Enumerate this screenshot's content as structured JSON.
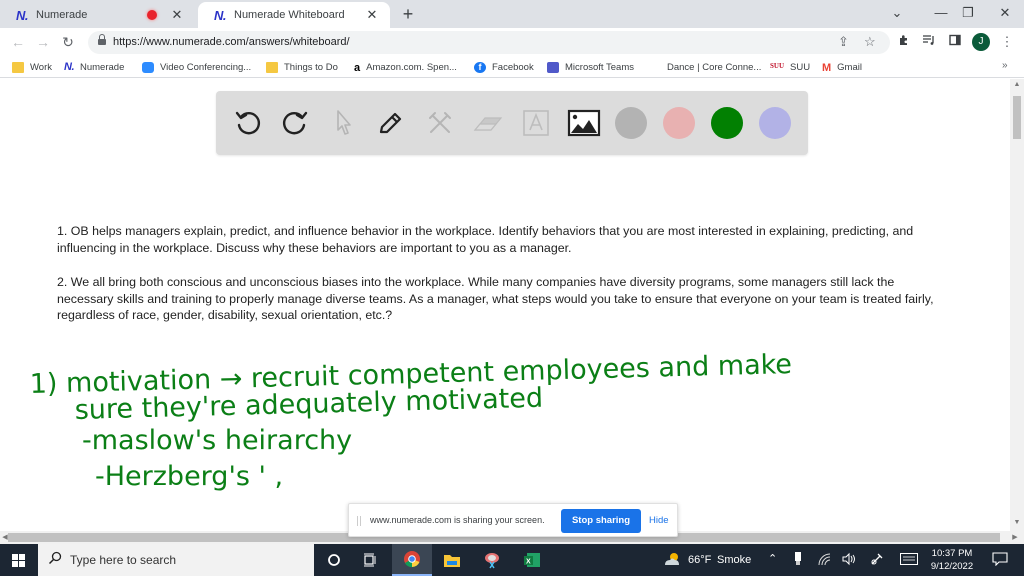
{
  "browser": {
    "tabs": [
      {
        "title": "Numerade",
        "logo": "N.",
        "recording": true,
        "active": false
      },
      {
        "title": "Numerade Whiteboard",
        "logo": "N.",
        "recording": false,
        "active": true
      }
    ],
    "new_tab_icon": "+",
    "window_controls": {
      "tab_search": "⌄",
      "minimize": "—",
      "restore": "❐",
      "close": "✕"
    },
    "nav": {
      "back": "←",
      "forward": "→",
      "reload": "↻"
    },
    "url": "https://www.numerade.com/answers/whiteboard/",
    "omnibox_icons": {
      "share": "⇪",
      "bookmark_star": "☆"
    },
    "toolbar_icons": {
      "extensions": "puzzle",
      "media": "≡♪",
      "side_panel": "▯",
      "menu": "⋮"
    },
    "profile_initial": "J",
    "bookmarks": [
      {
        "label": "Work",
        "icon": "folder-icon"
      },
      {
        "label": "Numerade",
        "icon": "numerade-icon"
      },
      {
        "label": "Video Conferencing...",
        "icon": "zoom-icon"
      },
      {
        "label": "Things to Do",
        "icon": "folder-icon"
      },
      {
        "label": "Amazon.com. Spen...",
        "icon": "amazon-icon"
      },
      {
        "label": "Facebook",
        "icon": "facebook-icon"
      },
      {
        "label": "Microsoft Teams",
        "icon": "teams-icon"
      },
      {
        "label": "Dance | Core Conne...",
        "icon": "blank-icon"
      },
      {
        "label": "SUU",
        "icon": "suu-icon"
      },
      {
        "label": "Gmail",
        "icon": "gmail-icon"
      }
    ],
    "bookmarks_overflow": "»"
  },
  "whiteboard": {
    "tools": [
      {
        "name": "undo",
        "enabled": true
      },
      {
        "name": "redo",
        "enabled": true
      },
      {
        "name": "select",
        "enabled": false
      },
      {
        "name": "pen",
        "enabled": true
      },
      {
        "name": "tools",
        "enabled": false
      },
      {
        "name": "eraser",
        "enabled": false
      },
      {
        "name": "text",
        "enabled": false
      },
      {
        "name": "image",
        "enabled": true
      }
    ],
    "colors": [
      {
        "name": "gray",
        "hex": "#b3b3b3"
      },
      {
        "name": "pink",
        "hex": "#e8b1b1"
      },
      {
        "name": "green",
        "hex": "#028002",
        "selected": true
      },
      {
        "name": "lavender",
        "hex": "#b2b2e6"
      }
    ],
    "questions": [
      "1. OB helps managers explain, predict, and influence behavior in the workplace. Identify behaviors that you are most interested in explaining, predicting, and influencing in the workplace. Discuss why these behaviors are important to you as a manager.",
      "2. We all bring both conscious and unconscious biases into the workplace. While many companies have diversity programs, some managers still lack the necessary skills and training to properly manage diverse teams. As a manager, what steps would you take to ensure that everyone on your team is treated fairly, regardless of race, gender, disability, sexual orientation, etc.?"
    ],
    "handwriting": {
      "ink_color": "#0b7f16",
      "lines": [
        "1) motivation → recruit competent employees and make",
        "sure they're adequately motivated",
        "-maslow's heirarchy",
        "-Herzberg's  '        ,"
      ]
    }
  },
  "share_bar": {
    "message": "www.numerade.com is sharing your screen.",
    "stop_label": "Stop sharing",
    "hide_label": "Hide"
  },
  "taskbar": {
    "search_placeholder": "Type here to search",
    "weather": {
      "temp": "66°F",
      "condition": "Smoke"
    },
    "time": "10:37 PM",
    "date": "9/12/2022"
  }
}
